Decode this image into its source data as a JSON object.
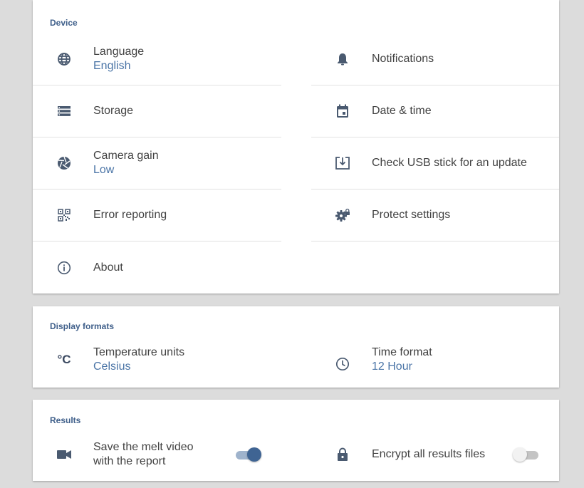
{
  "colors": {
    "accent": "#3f5f8a",
    "secondary_text": "#4a74a6",
    "icon": "#4a5a70",
    "background": "#dcdcdc",
    "card": "#ffffff"
  },
  "device": {
    "title": "Device",
    "items": [
      {
        "label": "Language",
        "value": "English",
        "icon": "globe-icon"
      },
      {
        "label": "Notifications",
        "icon": "bell-icon"
      },
      {
        "label": "Storage",
        "icon": "storage-icon"
      },
      {
        "label": "Date & time",
        "icon": "calendar-icon"
      },
      {
        "label": "Camera gain",
        "value": "Low",
        "icon": "aperture-icon"
      },
      {
        "label": "Check USB stick for an update",
        "icon": "download-box-icon"
      },
      {
        "label": "Error reporting",
        "icon": "qr-code-icon"
      },
      {
        "label": "Protect settings",
        "icon": "gear-lock-icon"
      },
      {
        "label": "About",
        "icon": "info-icon"
      }
    ]
  },
  "display_formats": {
    "title": "Display formats",
    "temperature": {
      "label": "Temperature units",
      "value": "Celsius",
      "icon_text": "°C"
    },
    "time": {
      "label": "Time format",
      "value": "12 Hour",
      "icon": "clock-icon"
    }
  },
  "results": {
    "title": "Results",
    "save_video": {
      "label_line1": "Save the melt video",
      "label_line2": "with the report",
      "enabled": true
    },
    "encrypt": {
      "label": "Encrypt all results files",
      "enabled": false
    }
  }
}
